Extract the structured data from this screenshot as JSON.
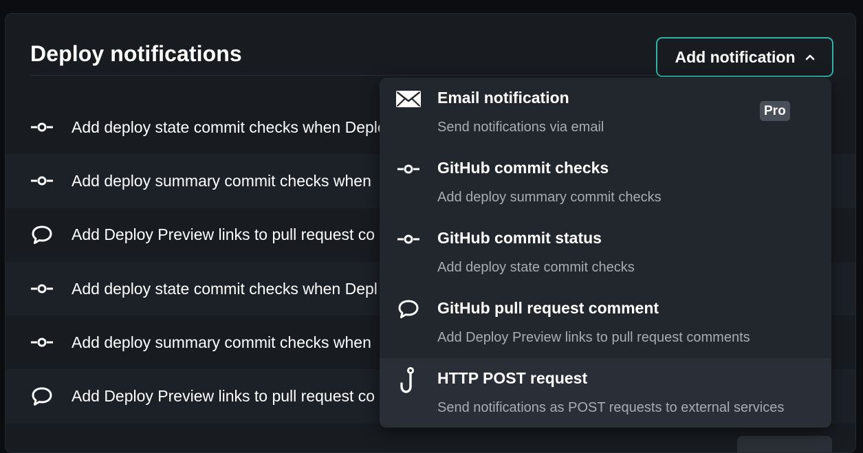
{
  "header": {
    "title": "Deploy notifications",
    "add_button_label": "Add notification",
    "add_button_icon": "chevron-up-icon",
    "accent_color": "#32b5a7"
  },
  "rows": [
    {
      "icon": "commit-icon",
      "label": "Add deploy state commit checks when Deploy"
    },
    {
      "icon": "commit-icon",
      "label": "Add deploy summary commit checks when"
    },
    {
      "icon": "comment-icon",
      "label": "Add Deploy Preview links to pull request co"
    },
    {
      "icon": "commit-icon",
      "label": "Add deploy state commit checks when Depl"
    },
    {
      "icon": "commit-icon",
      "label": "Add deploy summary commit checks when"
    },
    {
      "icon": "comment-icon",
      "label": "Add Deploy Preview links to pull request co"
    }
  ],
  "menu": {
    "items": [
      {
        "icon": "envelope-icon",
        "title": "Email notification",
        "description": "Send notifications via email",
        "badge": "Pro"
      },
      {
        "icon": "commit-icon",
        "title": "GitHub commit checks",
        "description": "Add deploy summary commit checks"
      },
      {
        "icon": "commit-icon",
        "title": "GitHub commit status",
        "description": "Add deploy state commit checks"
      },
      {
        "icon": "comment-icon",
        "title": "GitHub pull request comment",
        "description": "Add Deploy Preview links to pull request comments"
      },
      {
        "icon": "hook-icon",
        "title": "HTTP POST request",
        "description": "Send notifications as POST requests to external services"
      }
    ]
  }
}
